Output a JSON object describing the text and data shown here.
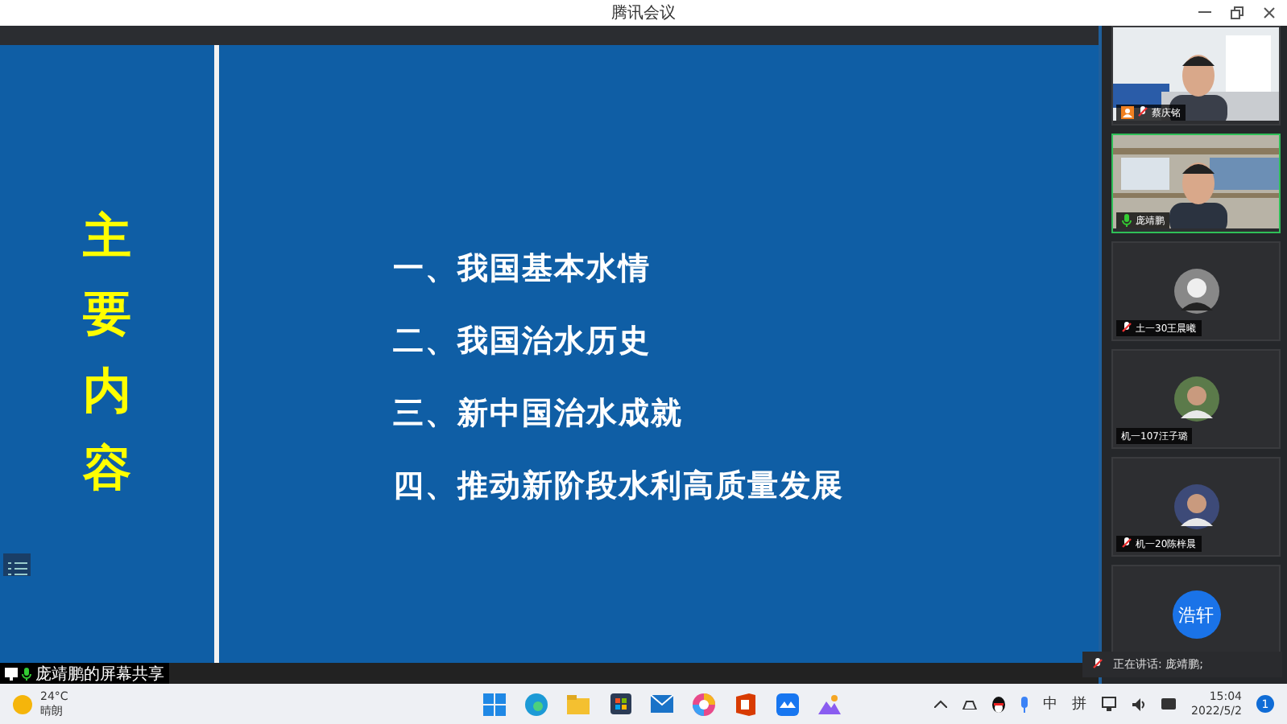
{
  "window": {
    "title": "腾讯会议"
  },
  "slide": {
    "side_title": "主要内容",
    "items": [
      "一、我国基本水情",
      "二、我国治水历史",
      "三、新中国治水成就",
      "四、推动新阶段水利高质量发展"
    ]
  },
  "share_label": "庞靖鹏的屏幕共享",
  "participants": [
    {
      "kind": "video",
      "name": "蔡庆铭",
      "muted": true,
      "speaking": false,
      "host": true,
      "selected": false
    },
    {
      "kind": "video",
      "name": "庞靖鹏",
      "muted": false,
      "speaking": true,
      "host": false,
      "selected": true
    },
    {
      "kind": "avatar",
      "name": "土一30王晨曦",
      "muted": true,
      "speaking": false,
      "host": false,
      "selected": false
    },
    {
      "kind": "avatar",
      "name": "机一107汪子璐",
      "muted": false,
      "speaking": false,
      "host": false,
      "selected": false
    },
    {
      "kind": "avatar",
      "name": "机一20陈梓晨",
      "muted": true,
      "speaking": false,
      "host": false,
      "selected": false
    },
    {
      "kind": "initials",
      "initials": "浩轩",
      "selected": false
    }
  ],
  "speaking_toast": "正在讲话: 庞靖鹏;",
  "taskbar": {
    "temperature": "24°C",
    "condition": "晴朗",
    "ime": [
      "中",
      "拼"
    ],
    "time": "15:04",
    "date": "2022/5/2",
    "notifications": "1"
  }
}
